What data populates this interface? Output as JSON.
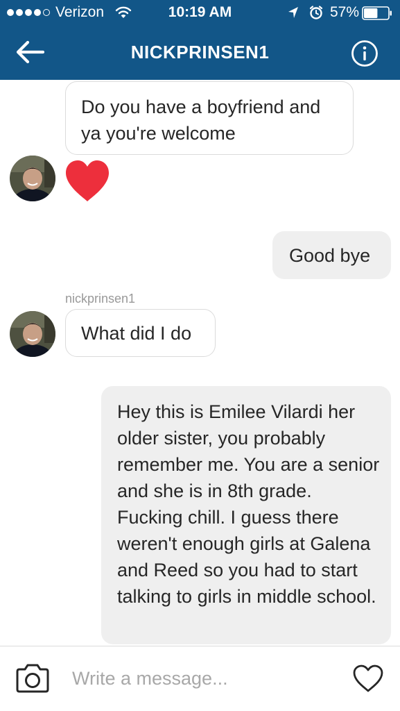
{
  "status_bar": {
    "carrier": "Verizon",
    "time": "10:19 AM",
    "battery_percent": "57%",
    "battery_level": 0.57,
    "signal_bars": 4,
    "signal_bars_total": 5,
    "icons": [
      "signal-dots-icon",
      "wifi-icon",
      "location-arrow-icon",
      "alarm-clock-icon",
      "battery-icon"
    ]
  },
  "header": {
    "title": "NICKPRINSEN1",
    "background_color": "#125688",
    "back_icon": "arrow-left-icon",
    "info_icon": "info-circle-icon"
  },
  "conversation": {
    "messages": [
      {
        "direction": "incoming",
        "text": "Do you have a boyfriend and ya you're welcome"
      },
      {
        "direction": "incoming",
        "type": "heart",
        "icon": "red-heart-icon",
        "color": "#ed4956"
      },
      {
        "direction": "outgoing",
        "text": "Good bye"
      },
      {
        "direction": "incoming",
        "sender": "nickprinsen1",
        "text": "What did I do"
      },
      {
        "direction": "outgoing",
        "text": "Hey this is Emilee Vilardi her older sister, you probably remember me. You are a senior and she is in 8th grade. Fucking chill. I guess there weren't enough girls at Galena and Reed so you had to start talking to girls in middle school."
      }
    ],
    "incoming_bubble_border": "#dbdbdb",
    "outgoing_bubble_color": "#efefef"
  },
  "composer": {
    "placeholder": "Write a message...",
    "value": "",
    "camera_icon": "camera-icon",
    "like_icon": "heart-outline-icon"
  }
}
